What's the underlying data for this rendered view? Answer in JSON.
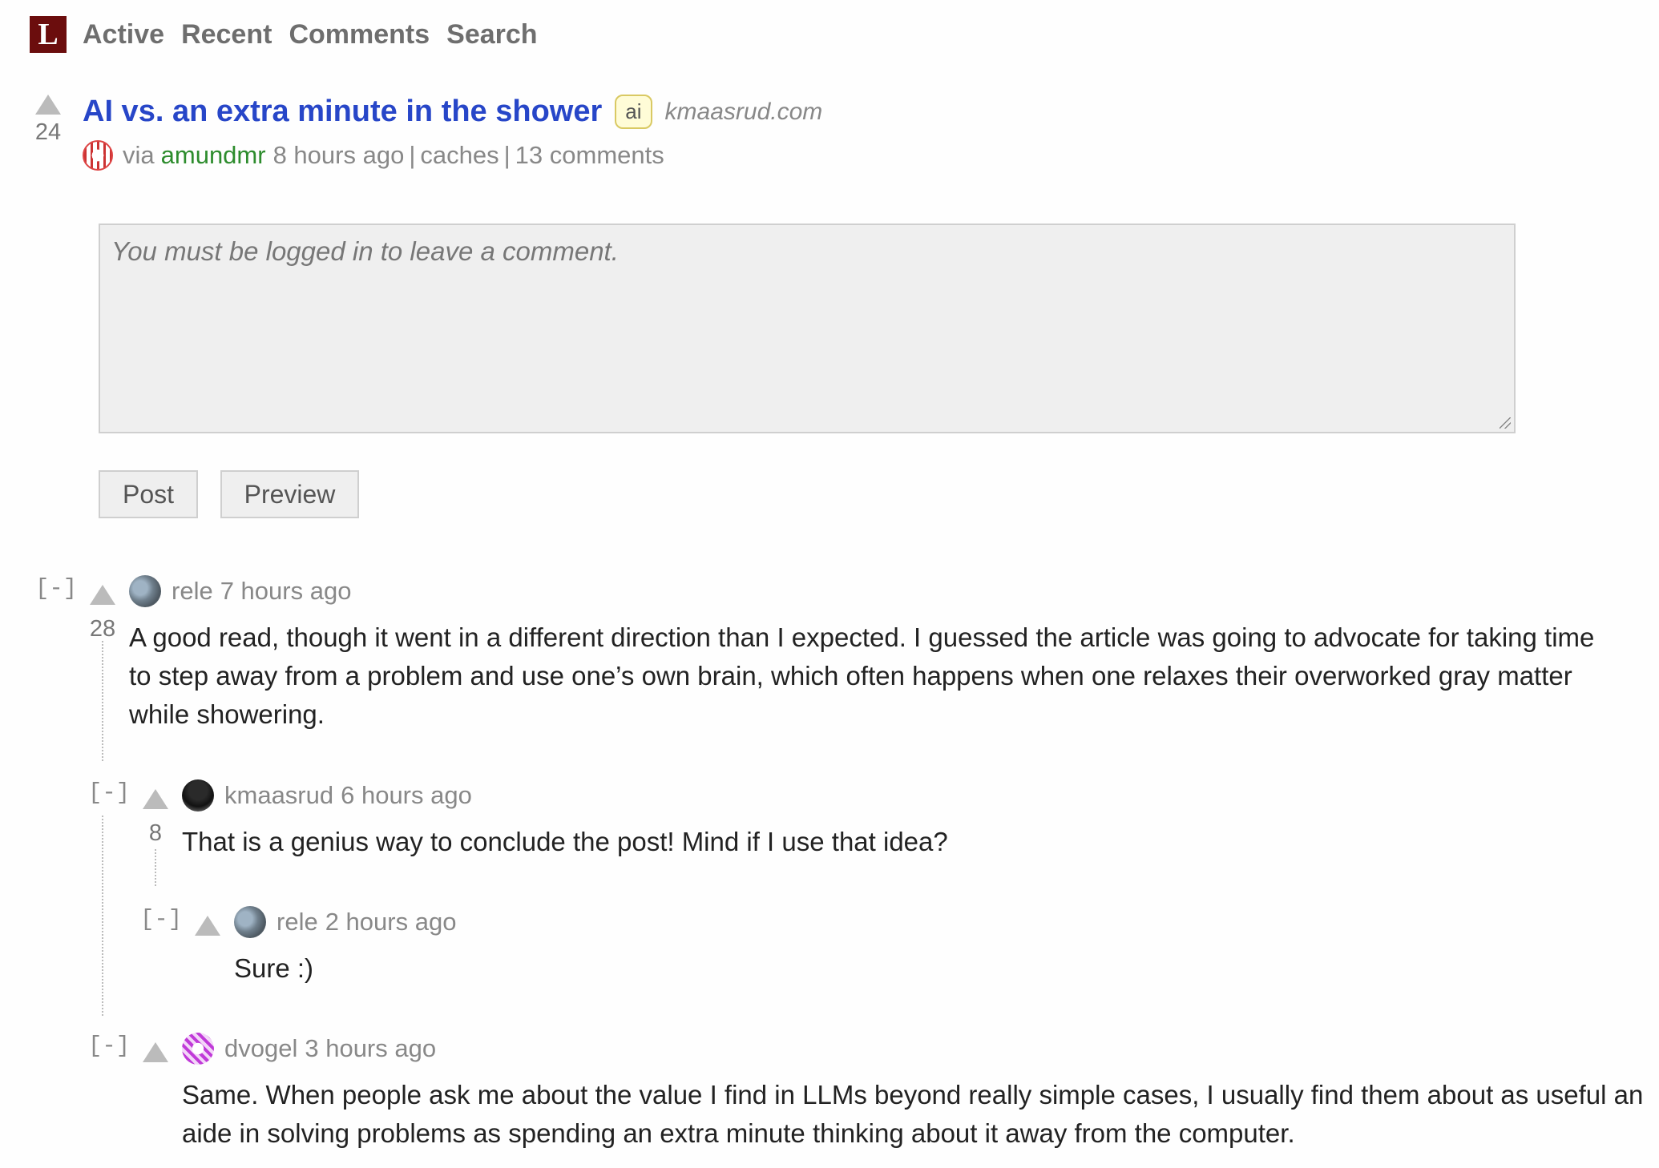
{
  "nav": {
    "logo": "L",
    "links": [
      "Active",
      "Recent",
      "Comments",
      "Search"
    ]
  },
  "story": {
    "score": "24",
    "title": "AI vs. an extra minute in the shower",
    "tag": "ai",
    "domain": "kmaasrud.com",
    "via": "via",
    "user": "amundmr",
    "time": "8 hours ago",
    "sep": "|",
    "caches": "caches",
    "comments": "13 comments"
  },
  "comment_form": {
    "placeholder": "You must be logged in to leave a comment.",
    "post_label": "Post",
    "preview_label": "Preview"
  },
  "comments": [
    {
      "collapse": "[-]",
      "score": "28",
      "user": "rele",
      "time": "7 hours ago",
      "body": "A good read, though it went in a different direction than I expected. I guessed the article was going to advocate for taking time to step away from a problem and use one’s own brain, which often happens when one relaxes their overworked gray matter while showering."
    },
    {
      "collapse": "[-]",
      "score": "8",
      "user": "kmaasrud",
      "time": "6 hours ago",
      "body": "That is a genius way to conclude the post! Mind if I use that idea?"
    },
    {
      "collapse": "[-]",
      "score": "",
      "user": "rele",
      "time": "2 hours ago",
      "body": "Sure :)"
    },
    {
      "collapse": "[-]",
      "score": "",
      "user": "dvogel",
      "time": "3 hours ago",
      "body": "Same. When people ask me about the value I find in LLMs beyond really simple cases, I usually find them about as useful an aide in solving problems as spending an extra minute thinking about it away from the computer."
    }
  ]
}
